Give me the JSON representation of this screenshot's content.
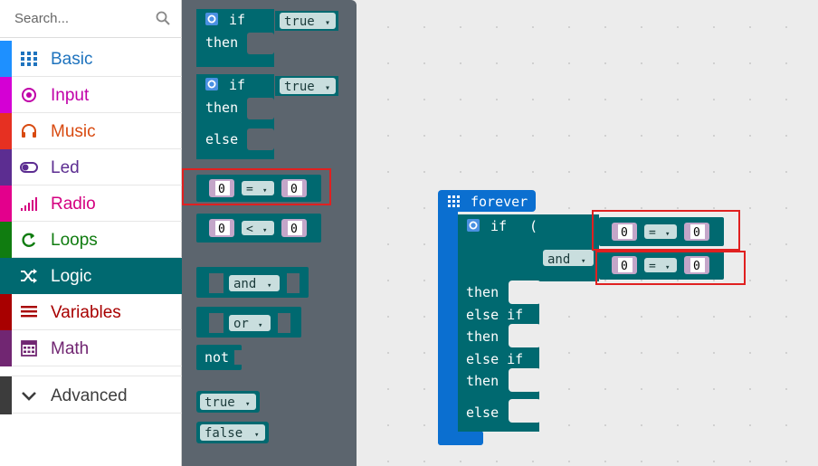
{
  "search": {
    "placeholder": "Search..."
  },
  "categories": [
    {
      "label": "Basic",
      "color": "#1e90ff",
      "text_color": "#1e73be",
      "icon": "grid-icon"
    },
    {
      "label": "Input",
      "color": "#d400d4",
      "text_color": "#c000a8",
      "icon": "radio-circle-icon"
    },
    {
      "label": "Music",
      "color": "#e63022",
      "text_color": "#d84a10",
      "icon": "headphones-icon"
    },
    {
      "label": "Led",
      "color": "#5c2d91",
      "text_color": "#5c2d91",
      "icon": "toggle-icon"
    },
    {
      "label": "Radio",
      "color": "#e3008c",
      "text_color": "#d40080",
      "icon": "signal-bars-icon"
    },
    {
      "label": "Loops",
      "color": "#107c10",
      "text_color": "#107c10",
      "icon": "loop-arrow-icon"
    },
    {
      "label": "Logic",
      "color": "#006970",
      "text_color": "#ffffff",
      "icon": "shuffle-icon",
      "selected": true
    },
    {
      "label": "Variables",
      "color": "#a80000",
      "text_color": "#a80000",
      "icon": "list-lines-icon"
    },
    {
      "label": "Math",
      "color": "#712672",
      "text_color": "#712672",
      "icon": "calculator-icon"
    }
  ],
  "advanced": {
    "label": "Advanced",
    "icon": "chevron-down-icon",
    "color": "#3c3c3c"
  },
  "flyout": {
    "if_label": "if",
    "then_label": "then",
    "else_label": "else",
    "true_label": "true",
    "false_label": "false",
    "zero": "0",
    "eq_op": "=",
    "lt_op": "<",
    "and_label": "and",
    "or_label": "or",
    "not_label": "not",
    "dropdown_arrow": "▾"
  },
  "workspace": {
    "forever_label": "forever",
    "if_label": "if",
    "and_label": "and",
    "then_label": "then",
    "elseif_label": "else if",
    "else_label": "else",
    "zero": "0",
    "eq_op": "=",
    "dropdown_arrow": "▾"
  },
  "colors": {
    "logic": "#006970",
    "loops_blue": "#0b6fd0",
    "math_pill": "#c4a6c9",
    "flyout_bg": "#5c656e"
  }
}
